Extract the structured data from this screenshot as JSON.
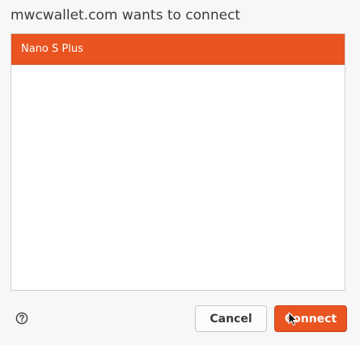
{
  "dialog": {
    "title": "mwcwallet.com wants to connect"
  },
  "devices": [
    {
      "label": "Nano S Plus",
      "selected": true
    }
  ],
  "buttons": {
    "cancel_label": "Cancel",
    "connect_label": "Connect"
  },
  "icons": {
    "help": "help-icon",
    "cursor": "mouse-pointer-icon"
  },
  "colors": {
    "accent": "#e95420",
    "background": "#f7f7f7",
    "list_background": "#ffffff"
  }
}
